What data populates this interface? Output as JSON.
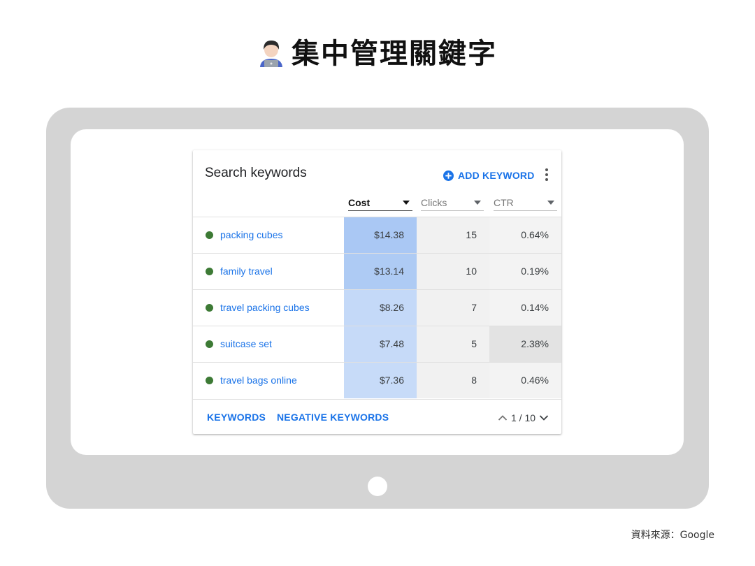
{
  "page": {
    "title": "集中管理關鍵字",
    "title_icon": "technologist-emoji-icon",
    "source": "資料來源：Google"
  },
  "card": {
    "title": "Search keywords",
    "add_keyword_label": "ADD KEYWORD",
    "columns": [
      {
        "label": "Cost",
        "sorted": true
      },
      {
        "label": "Clicks",
        "sorted": false
      },
      {
        "label": "CTR",
        "sorted": false
      }
    ],
    "rows": [
      {
        "keyword": "packing cubes",
        "cost": "$14.38",
        "clicks": "15",
        "ctr": "0.64%",
        "status": "active"
      },
      {
        "keyword": "family travel",
        "cost": "$13.14",
        "clicks": "10",
        "ctr": "0.19%",
        "status": "active"
      },
      {
        "keyword": "travel packing cubes",
        "cost": "$8.26",
        "clicks": "7",
        "ctr": "0.14%",
        "status": "active"
      },
      {
        "keyword": "suitcase set",
        "cost": "$7.48",
        "clicks": "5",
        "ctr": "2.38%",
        "status": "active"
      },
      {
        "keyword": "travel bags online",
        "cost": "$7.36",
        "clicks": "8",
        "ctr": "0.46%",
        "status": "active"
      }
    ],
    "footer": {
      "tab_keywords": "KEYWORDS",
      "tab_negative": "NEGATIVE KEYWORDS",
      "pagination": "1 / 10"
    }
  },
  "colors": {
    "accent": "#1a73e8",
    "status_active": "#3d7a35",
    "cost_heat_high": "#aac8f4",
    "cost_heat_low": "#c6daf8",
    "ctr_highlight": "#e3e3e3",
    "device_frame": "#d4d4d4"
  }
}
